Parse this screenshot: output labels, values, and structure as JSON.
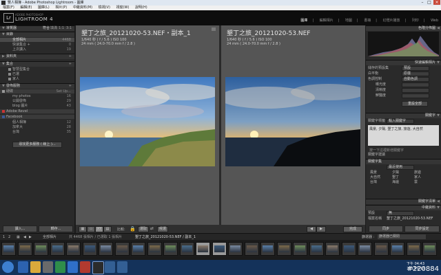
{
  "window": {
    "title": "雙人相簿 - Adobe Photoshop Lightroom - 圖庫"
  },
  "menu": [
    "檔案(F)",
    "編輯(E)",
    "圖庫(L)",
    "相片(P)",
    "中繼資料(M)",
    "檢視(V)",
    "視窗(W)",
    "說明(H)"
  ],
  "brand": {
    "small": "ADOBE PHOTOSHOP",
    "name": "LIGHTROOM 4",
    "badge": "Lr"
  },
  "modules": [
    {
      "label": "圖庫",
      "active": true
    },
    {
      "label": "編輯相片",
      "active": false
    },
    {
      "label": "地圖",
      "active": false
    },
    {
      "label": "書冊",
      "active": false
    },
    {
      "label": "幻燈片播放",
      "active": false
    },
    {
      "label": "列印",
      "active": false
    },
    {
      "label": "Web",
      "active": false
    }
  ],
  "left": {
    "navigator": {
      "title": "導覽器",
      "fit": "符合",
      "fill": "填滿",
      "r1": "1:1",
      "r2": "3:1"
    },
    "catalog": {
      "title": "目錄",
      "rows": [
        {
          "label": "全部相片",
          "count": "4468",
          "selected": true
        },
        {
          "label": "快速集合 +",
          "count": "0",
          "selected": false
        },
        {
          "label": "上次讀入",
          "count": "19",
          "selected": false
        }
      ]
    },
    "folders": {
      "title": "資料夾"
    },
    "collections": {
      "title": "集合",
      "rows": [
        {
          "label": "智慧型集合"
        },
        {
          "label": "已選"
        },
        {
          "label": "家人"
        }
      ]
    },
    "publish": {
      "title": "發佈服務",
      "rows": [
        {
          "label": "硬碟",
          "count": "Set Up..."
        },
        {
          "label": "my photos",
          "count": "16"
        },
        {
          "label": "公開發佈",
          "count": "29"
        },
        {
          "label": "blog 圖片",
          "count": "43"
        },
        {
          "label": "Adobe Revel",
          "count": ""
        },
        {
          "label": "Facebook",
          "count": ""
        },
        {
          "label": "個人相簿",
          "count": "12"
        },
        {
          "label": "加拿大",
          "count": "28"
        },
        {
          "label": "台灣",
          "count": "35"
        }
      ],
      "find_more": "尋找更多服務 ( 線上 )..."
    },
    "import_btn": "讀入...",
    "export_btn": "轉存..."
  },
  "compare": {
    "left": {
      "name": "墾丁之旅_20121020-53.NEF・副本_1",
      "line1": "1/640 秒 ( f / 5.6 ) ISO 100",
      "line2": "24 mm ( 24.0-70.0 mm f / 2.8 )"
    },
    "right": {
      "name": "墾丁之旅_20121020-53.NEF",
      "line1": "1/640 秒 ( f / 5.6 ) ISO 100",
      "line2": "24 mm ( 24.0-70.0 mm f / 2.8 )"
    }
  },
  "toolbar": {
    "compare_label": "比較:",
    "select_label": "選取",
    "candidate_label": "候選",
    "done": "完成"
  },
  "right": {
    "histogram": {
      "title": "色階分佈圖"
    },
    "quick_develop": {
      "title": "快速編輯相片",
      "rows": [
        {
          "label": "儲存的預設集",
          "value": "預設"
        },
        {
          "label": "白平衡",
          "value": "原樣"
        },
        {
          "label": "色調控制",
          "value": "自動色調"
        },
        {
          "label": "曝光度",
          "value": ""
        },
        {
          "label": "清晰度",
          "value": ""
        },
        {
          "label": "鮮豔度",
          "value": ""
        }
      ],
      "reset": "重設全部"
    },
    "keywording": {
      "title": "關鍵字",
      "tags_label": "關鍵字標籤",
      "tags_mode": "輸入關鍵字",
      "tags_value": "風景, 夕陽, 墾丁之旅, 旅遊, 大自然",
      "hint": "按一下這裡新增關鍵字",
      "suggest": "關鍵字建議"
    },
    "keyword_set": {
      "title": "關鍵字集",
      "set_value": "最近使用",
      "words": [
        "風景",
        "夕陽",
        "旅遊",
        "大自然",
        "墾丁",
        "家人",
        "台灣",
        "海邊",
        "雲"
      ]
    },
    "keyword_list": {
      "title": "關鍵字清單"
    },
    "metadata": {
      "title": "中繼資料",
      "preset_label": "預設",
      "preset_value": "無",
      "file_label": "檔案名稱",
      "file_value": "墾丁之旅_20121020-53.NEF"
    },
    "sync_btn": "同步",
    "sync_settings_btn": "同步設定"
  },
  "filmstrip": {
    "pages": [
      "1",
      "2"
    ],
    "source": "全部相片",
    "count": "共 4468 張相片 / 已選取 1 張相片",
    "file": "墾丁之旅_20121020-53.NEF / 副本_1",
    "filter_label": "篩選器 :",
    "filter_value": "篩選器已關閉"
  },
  "taskbar": {
    "time": "下午 04:43",
    "date": "2013/9/13"
  },
  "watermark": "#220884"
}
